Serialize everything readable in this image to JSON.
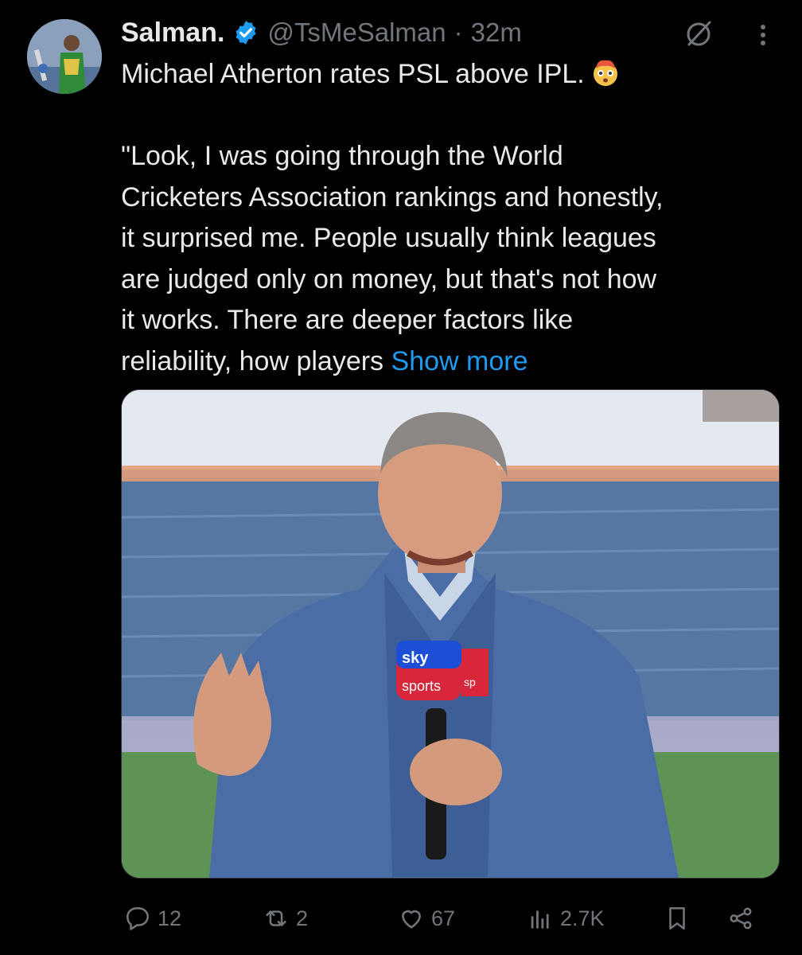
{
  "tweet": {
    "author_name": "Salman.",
    "handle": "@TsMeSalman",
    "separator": "·",
    "time": "32m",
    "headline": "Michael Atherton rates PSL above IPL.",
    "headline_emoji": "flushed-exploding-head-emoji",
    "body_lines": [
      "\"Look, I was going through the World",
      "Cricketers Association rankings and honestly,",
      "it surprised me. People usually think leagues",
      "are judged only on money, but that's not how",
      "it works. There are deeper factors like",
      "reliability, how players"
    ],
    "show_more": "Show more"
  },
  "media": {
    "mic_flag_top": "sky",
    "mic_flag_bottom": "sports",
    "mic_flag_side": "sp"
  },
  "actions": {
    "replies": "12",
    "reposts": "2",
    "likes": "67",
    "views": "2.7K"
  },
  "colors": {
    "background": "#000000",
    "text": "#e7e9ea",
    "muted": "#71767b",
    "accent": "#1d9bf0"
  },
  "icons": [
    "verified-badge-icon",
    "grok-icon",
    "more-icon",
    "reply-icon",
    "repost-icon",
    "like-icon",
    "views-icon",
    "bookmark-icon",
    "share-icon"
  ]
}
